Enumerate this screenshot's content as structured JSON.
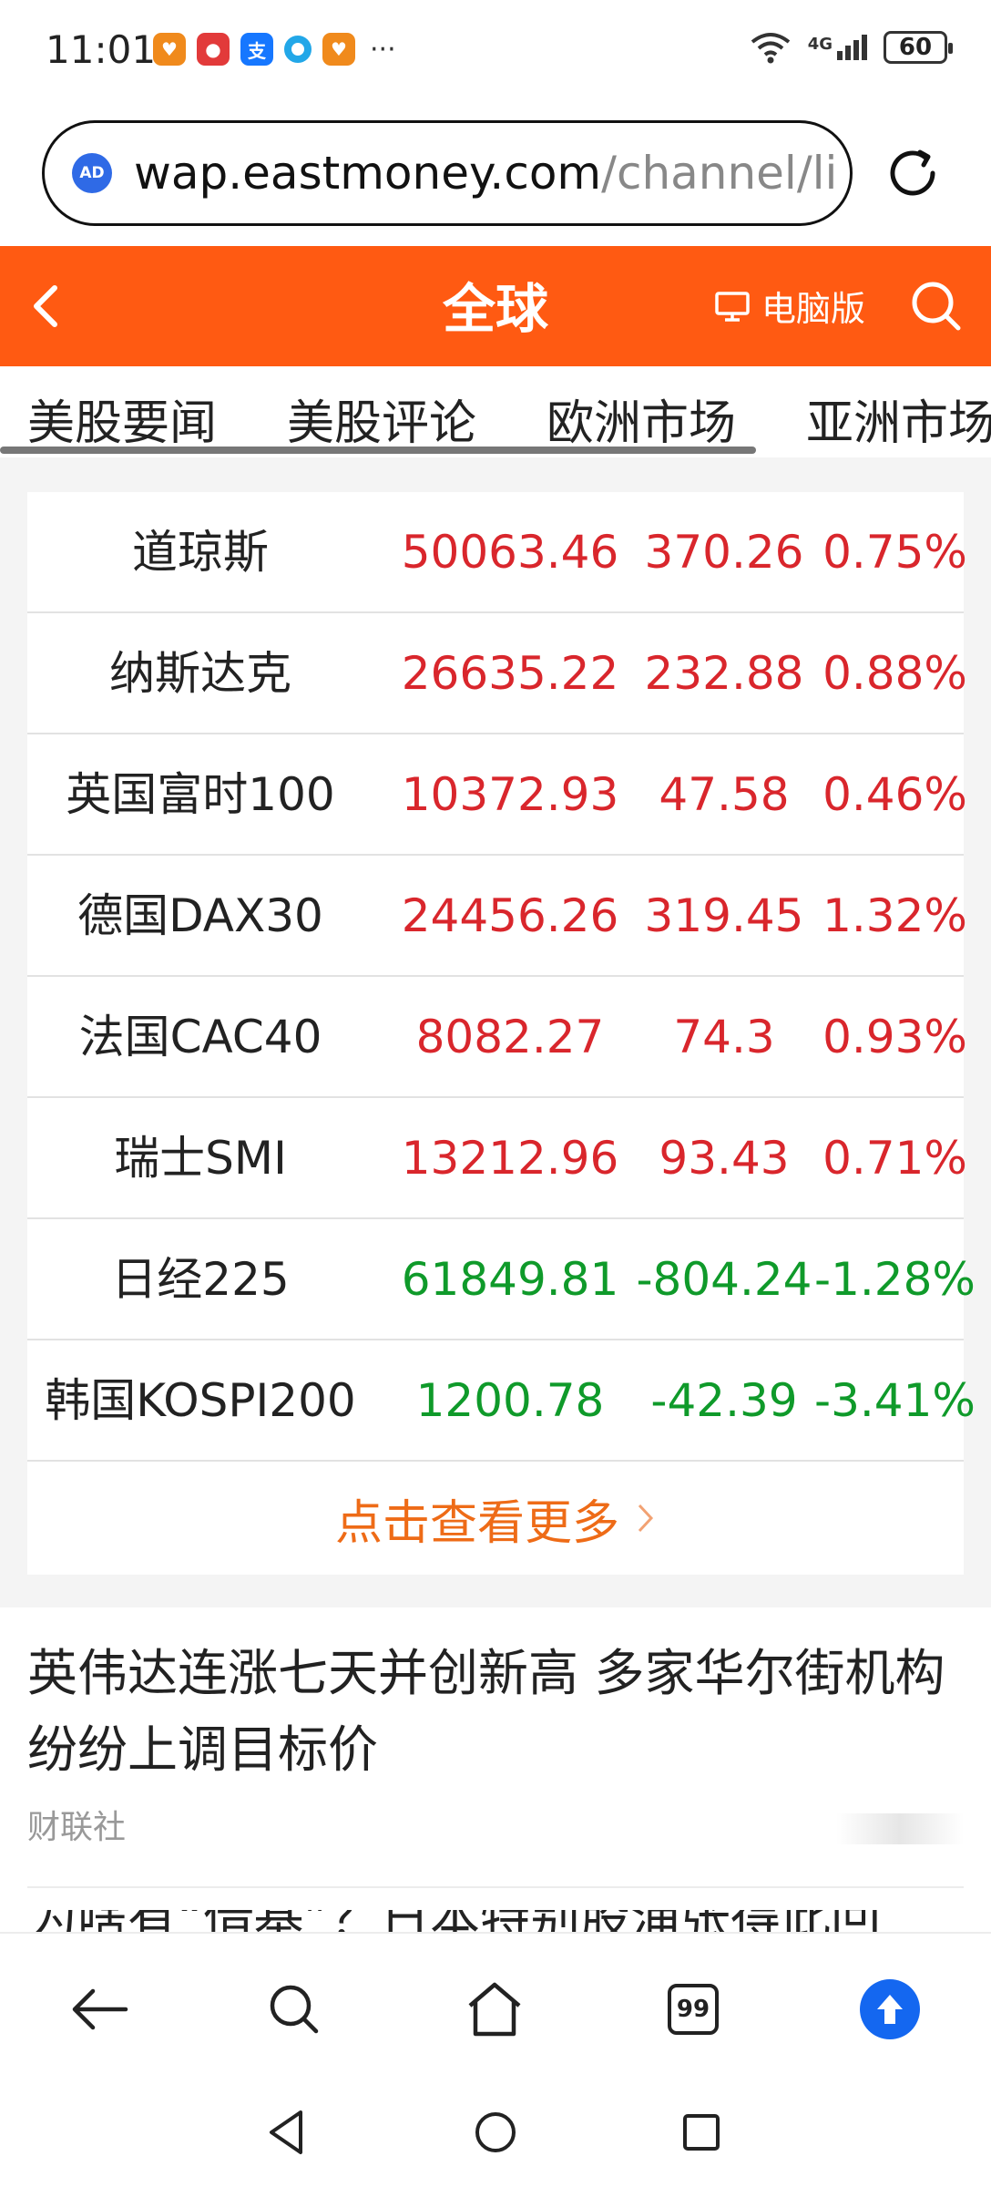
{
  "status_bar": {
    "time": "11:01",
    "more": "···",
    "network": "4G",
    "battery": "60",
    "app_icons": [
      "app-icon-orange-1",
      "app-icon-red",
      "alipay-icon",
      "app-icon-blue",
      "app-icon-orange-2"
    ]
  },
  "url_bar": {
    "ad_label": "AD",
    "url_host": "wap.eastmoney.com",
    "url_path": "/channel/lis"
  },
  "header": {
    "title": "全球",
    "pc_version": "电脑版",
    "accent_color": "#ff5a12"
  },
  "tabs": [
    "美股要闻",
    "美股评论",
    "欧洲市场",
    "亚洲市场"
  ],
  "indices": [
    {
      "name": "道琼斯",
      "price": "50063.46",
      "change": "370.26",
      "pct": "0.75%",
      "dir": "up"
    },
    {
      "name": "纳斯达克",
      "price": "26635.22",
      "change": "232.88",
      "pct": "0.88%",
      "dir": "up"
    },
    {
      "name": "英国富时100",
      "price": "10372.93",
      "change": "47.58",
      "pct": "0.46%",
      "dir": "up"
    },
    {
      "name": "德国DAX30",
      "price": "24456.26",
      "change": "319.45",
      "pct": "1.32%",
      "dir": "up"
    },
    {
      "name": "法国CAC40",
      "price": "8082.27",
      "change": "74.3",
      "pct": "0.93%",
      "dir": "up"
    },
    {
      "name": "瑞士SMI",
      "price": "13212.96",
      "change": "93.43",
      "pct": "0.71%",
      "dir": "up"
    },
    {
      "name": "日经225",
      "price": "61849.81",
      "change": "-804.24",
      "pct": "-1.28%",
      "dir": "down"
    },
    {
      "name": "韩国KOSPI200",
      "price": "1200.78",
      "change": "-42.39",
      "pct": "-3.41%",
      "dir": "down"
    }
  ],
  "more_label": "点击查看更多",
  "news": [
    {
      "title": "英伟达连涨七天并创新高 多家华尔街机构纷纷上调目标价",
      "source": "财联社"
    },
    {
      "title": "为啥有“借基”？日本特别股涌张得此回"
    }
  ],
  "toolbar": {
    "tab_count": "99"
  },
  "colors": {
    "up": "#d9262c",
    "down": "#0f9a2a",
    "more": "#ee6b17"
  }
}
